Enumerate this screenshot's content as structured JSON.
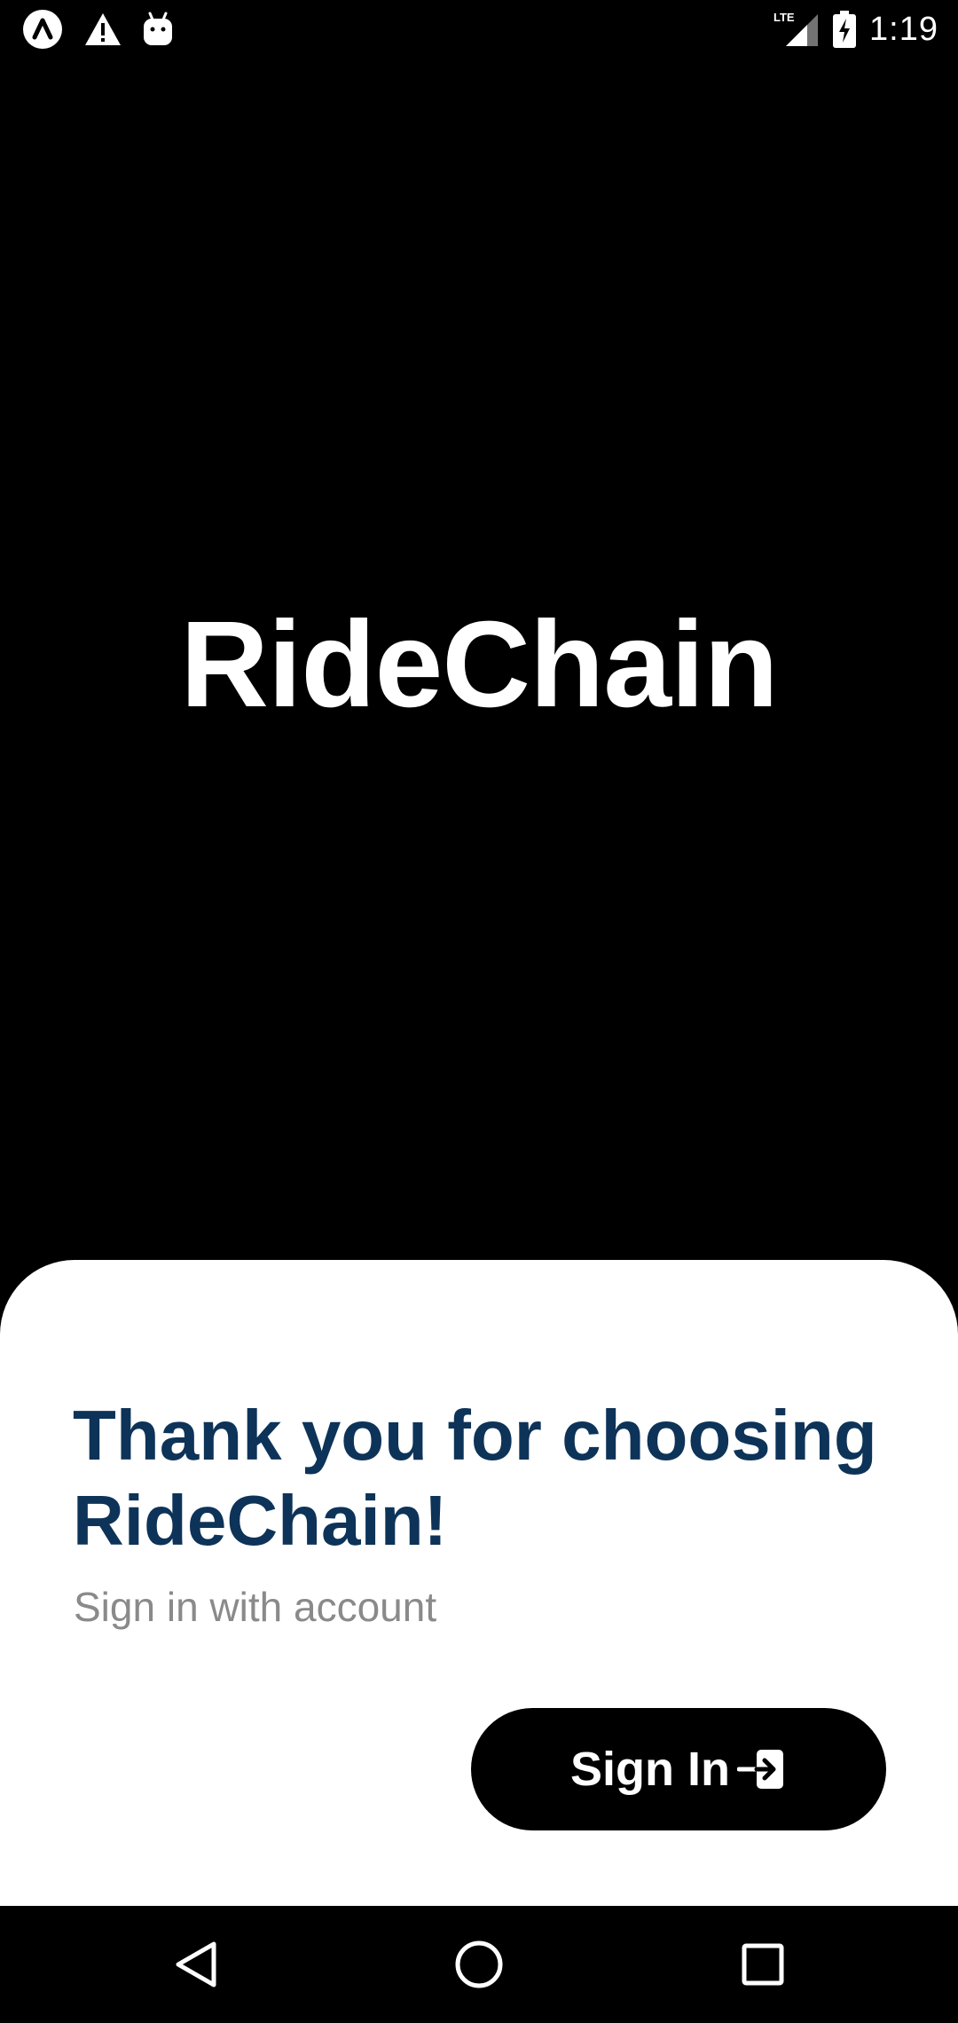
{
  "status_bar": {
    "time": "1:19",
    "network": "LTE",
    "left_icons": [
      "app-notification-icon",
      "warning-icon",
      "android-icon"
    ],
    "right_icons": [
      "lte-signal-icon",
      "battery-charging-icon"
    ]
  },
  "app": {
    "brand": "RideChain"
  },
  "sheet": {
    "title": "Thank you for choosing RideChain!",
    "subtitle": "Sign in with account",
    "signin_label": "Sign In",
    "signin_icon": "login-arrow-icon"
  },
  "nav_bar": {
    "buttons": [
      "back-icon",
      "home-icon",
      "recents-icon"
    ]
  },
  "colors": {
    "background": "#000000",
    "sheet": "#ffffff",
    "title": "#0d3358",
    "subtitle": "#8a8a8a",
    "button": "#000000"
  }
}
